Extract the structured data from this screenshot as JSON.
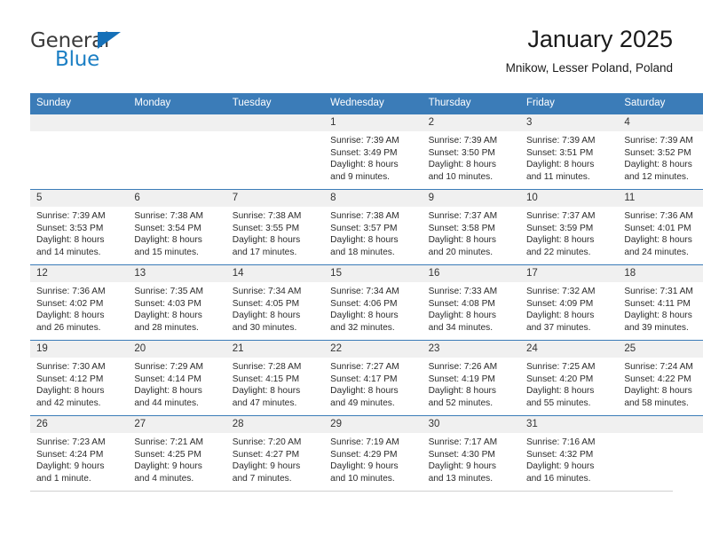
{
  "logo": {
    "line1": "General",
    "line2": "Blue",
    "triangle_icon": "triangle-icon",
    "color_text": "#3b3b3b",
    "color_blue": "#1c7fc4"
  },
  "header": {
    "title": "January 2025",
    "subtitle": "Mnikow, Lesser Poland, Poland"
  },
  "theme": {
    "header_bg": "#3b7cb8",
    "header_text": "#ffffff",
    "daynum_bg": "#f0f0f0",
    "grid_line": "#3b7cb8"
  },
  "weekdays": [
    "Sunday",
    "Monday",
    "Tuesday",
    "Wednesday",
    "Thursday",
    "Friday",
    "Saturday"
  ],
  "weeks": [
    [
      {
        "day": "",
        "sunrise": "",
        "sunset": "",
        "daylight1": "",
        "daylight2": ""
      },
      {
        "day": "",
        "sunrise": "",
        "sunset": "",
        "daylight1": "",
        "daylight2": ""
      },
      {
        "day": "",
        "sunrise": "",
        "sunset": "",
        "daylight1": "",
        "daylight2": ""
      },
      {
        "day": "1",
        "sunrise": "Sunrise: 7:39 AM",
        "sunset": "Sunset: 3:49 PM",
        "daylight1": "Daylight: 8 hours",
        "daylight2": "and 9 minutes."
      },
      {
        "day": "2",
        "sunrise": "Sunrise: 7:39 AM",
        "sunset": "Sunset: 3:50 PM",
        "daylight1": "Daylight: 8 hours",
        "daylight2": "and 10 minutes."
      },
      {
        "day": "3",
        "sunrise": "Sunrise: 7:39 AM",
        "sunset": "Sunset: 3:51 PM",
        "daylight1": "Daylight: 8 hours",
        "daylight2": "and 11 minutes."
      },
      {
        "day": "4",
        "sunrise": "Sunrise: 7:39 AM",
        "sunset": "Sunset: 3:52 PM",
        "daylight1": "Daylight: 8 hours",
        "daylight2": "and 12 minutes."
      }
    ],
    [
      {
        "day": "5",
        "sunrise": "Sunrise: 7:39 AM",
        "sunset": "Sunset: 3:53 PM",
        "daylight1": "Daylight: 8 hours",
        "daylight2": "and 14 minutes."
      },
      {
        "day": "6",
        "sunrise": "Sunrise: 7:38 AM",
        "sunset": "Sunset: 3:54 PM",
        "daylight1": "Daylight: 8 hours",
        "daylight2": "and 15 minutes."
      },
      {
        "day": "7",
        "sunrise": "Sunrise: 7:38 AM",
        "sunset": "Sunset: 3:55 PM",
        "daylight1": "Daylight: 8 hours",
        "daylight2": "and 17 minutes."
      },
      {
        "day": "8",
        "sunrise": "Sunrise: 7:38 AM",
        "sunset": "Sunset: 3:57 PM",
        "daylight1": "Daylight: 8 hours",
        "daylight2": "and 18 minutes."
      },
      {
        "day": "9",
        "sunrise": "Sunrise: 7:37 AM",
        "sunset": "Sunset: 3:58 PM",
        "daylight1": "Daylight: 8 hours",
        "daylight2": "and 20 minutes."
      },
      {
        "day": "10",
        "sunrise": "Sunrise: 7:37 AM",
        "sunset": "Sunset: 3:59 PM",
        "daylight1": "Daylight: 8 hours",
        "daylight2": "and 22 minutes."
      },
      {
        "day": "11",
        "sunrise": "Sunrise: 7:36 AM",
        "sunset": "Sunset: 4:01 PM",
        "daylight1": "Daylight: 8 hours",
        "daylight2": "and 24 minutes."
      }
    ],
    [
      {
        "day": "12",
        "sunrise": "Sunrise: 7:36 AM",
        "sunset": "Sunset: 4:02 PM",
        "daylight1": "Daylight: 8 hours",
        "daylight2": "and 26 minutes."
      },
      {
        "day": "13",
        "sunrise": "Sunrise: 7:35 AM",
        "sunset": "Sunset: 4:03 PM",
        "daylight1": "Daylight: 8 hours",
        "daylight2": "and 28 minutes."
      },
      {
        "day": "14",
        "sunrise": "Sunrise: 7:34 AM",
        "sunset": "Sunset: 4:05 PM",
        "daylight1": "Daylight: 8 hours",
        "daylight2": "and 30 minutes."
      },
      {
        "day": "15",
        "sunrise": "Sunrise: 7:34 AM",
        "sunset": "Sunset: 4:06 PM",
        "daylight1": "Daylight: 8 hours",
        "daylight2": "and 32 minutes."
      },
      {
        "day": "16",
        "sunrise": "Sunrise: 7:33 AM",
        "sunset": "Sunset: 4:08 PM",
        "daylight1": "Daylight: 8 hours",
        "daylight2": "and 34 minutes."
      },
      {
        "day": "17",
        "sunrise": "Sunrise: 7:32 AM",
        "sunset": "Sunset: 4:09 PM",
        "daylight1": "Daylight: 8 hours",
        "daylight2": "and 37 minutes."
      },
      {
        "day": "18",
        "sunrise": "Sunrise: 7:31 AM",
        "sunset": "Sunset: 4:11 PM",
        "daylight1": "Daylight: 8 hours",
        "daylight2": "and 39 minutes."
      }
    ],
    [
      {
        "day": "19",
        "sunrise": "Sunrise: 7:30 AM",
        "sunset": "Sunset: 4:12 PM",
        "daylight1": "Daylight: 8 hours",
        "daylight2": "and 42 minutes."
      },
      {
        "day": "20",
        "sunrise": "Sunrise: 7:29 AM",
        "sunset": "Sunset: 4:14 PM",
        "daylight1": "Daylight: 8 hours",
        "daylight2": "and 44 minutes."
      },
      {
        "day": "21",
        "sunrise": "Sunrise: 7:28 AM",
        "sunset": "Sunset: 4:15 PM",
        "daylight1": "Daylight: 8 hours",
        "daylight2": "and 47 minutes."
      },
      {
        "day": "22",
        "sunrise": "Sunrise: 7:27 AM",
        "sunset": "Sunset: 4:17 PM",
        "daylight1": "Daylight: 8 hours",
        "daylight2": "and 49 minutes."
      },
      {
        "day": "23",
        "sunrise": "Sunrise: 7:26 AM",
        "sunset": "Sunset: 4:19 PM",
        "daylight1": "Daylight: 8 hours",
        "daylight2": "and 52 minutes."
      },
      {
        "day": "24",
        "sunrise": "Sunrise: 7:25 AM",
        "sunset": "Sunset: 4:20 PM",
        "daylight1": "Daylight: 8 hours",
        "daylight2": "and 55 minutes."
      },
      {
        "day": "25",
        "sunrise": "Sunrise: 7:24 AM",
        "sunset": "Sunset: 4:22 PM",
        "daylight1": "Daylight: 8 hours",
        "daylight2": "and 58 minutes."
      }
    ],
    [
      {
        "day": "26",
        "sunrise": "Sunrise: 7:23 AM",
        "sunset": "Sunset: 4:24 PM",
        "daylight1": "Daylight: 9 hours",
        "daylight2": "and 1 minute."
      },
      {
        "day": "27",
        "sunrise": "Sunrise: 7:21 AM",
        "sunset": "Sunset: 4:25 PM",
        "daylight1": "Daylight: 9 hours",
        "daylight2": "and 4 minutes."
      },
      {
        "day": "28",
        "sunrise": "Sunrise: 7:20 AM",
        "sunset": "Sunset: 4:27 PM",
        "daylight1": "Daylight: 9 hours",
        "daylight2": "and 7 minutes."
      },
      {
        "day": "29",
        "sunrise": "Sunrise: 7:19 AM",
        "sunset": "Sunset: 4:29 PM",
        "daylight1": "Daylight: 9 hours",
        "daylight2": "and 10 minutes."
      },
      {
        "day": "30",
        "sunrise": "Sunrise: 7:17 AM",
        "sunset": "Sunset: 4:30 PM",
        "daylight1": "Daylight: 9 hours",
        "daylight2": "and 13 minutes."
      },
      {
        "day": "31",
        "sunrise": "Sunrise: 7:16 AM",
        "sunset": "Sunset: 4:32 PM",
        "daylight1": "Daylight: 9 hours",
        "daylight2": "and 16 minutes."
      },
      {
        "day": "",
        "sunrise": "",
        "sunset": "",
        "daylight1": "",
        "daylight2": ""
      }
    ]
  ]
}
